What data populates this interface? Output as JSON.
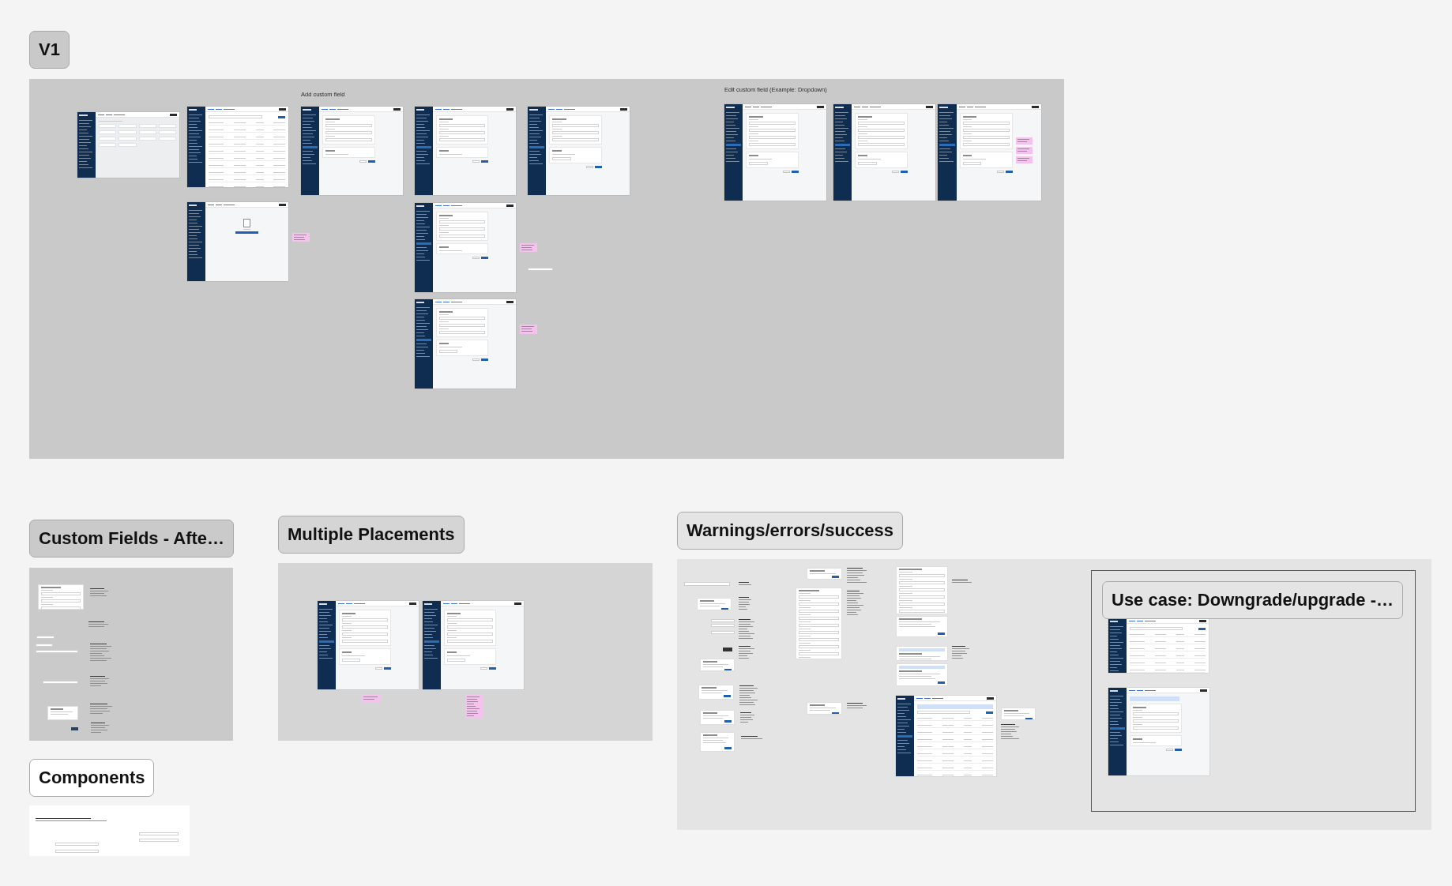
{
  "canvas": {
    "sections": [
      {
        "title": "V1",
        "color": "#c9c9c9",
        "headings": [
          "Add custom field",
          "Edit custom field (Example: Dropdown)"
        ]
      },
      {
        "title": "Custom Fields - Afte…",
        "color": "#cacaca"
      },
      {
        "title": "Components",
        "color": "#ffffff"
      },
      {
        "title": "Multiple Placements",
        "color": "#d5d5d5"
      },
      {
        "title": "Warnings/errors/success",
        "color": "#e4e4e4",
        "sections": [
          {
            "title": "Use case: Downgrade/upgrade -…",
            "color": "#e4e4e4"
          }
        ]
      }
    ]
  }
}
